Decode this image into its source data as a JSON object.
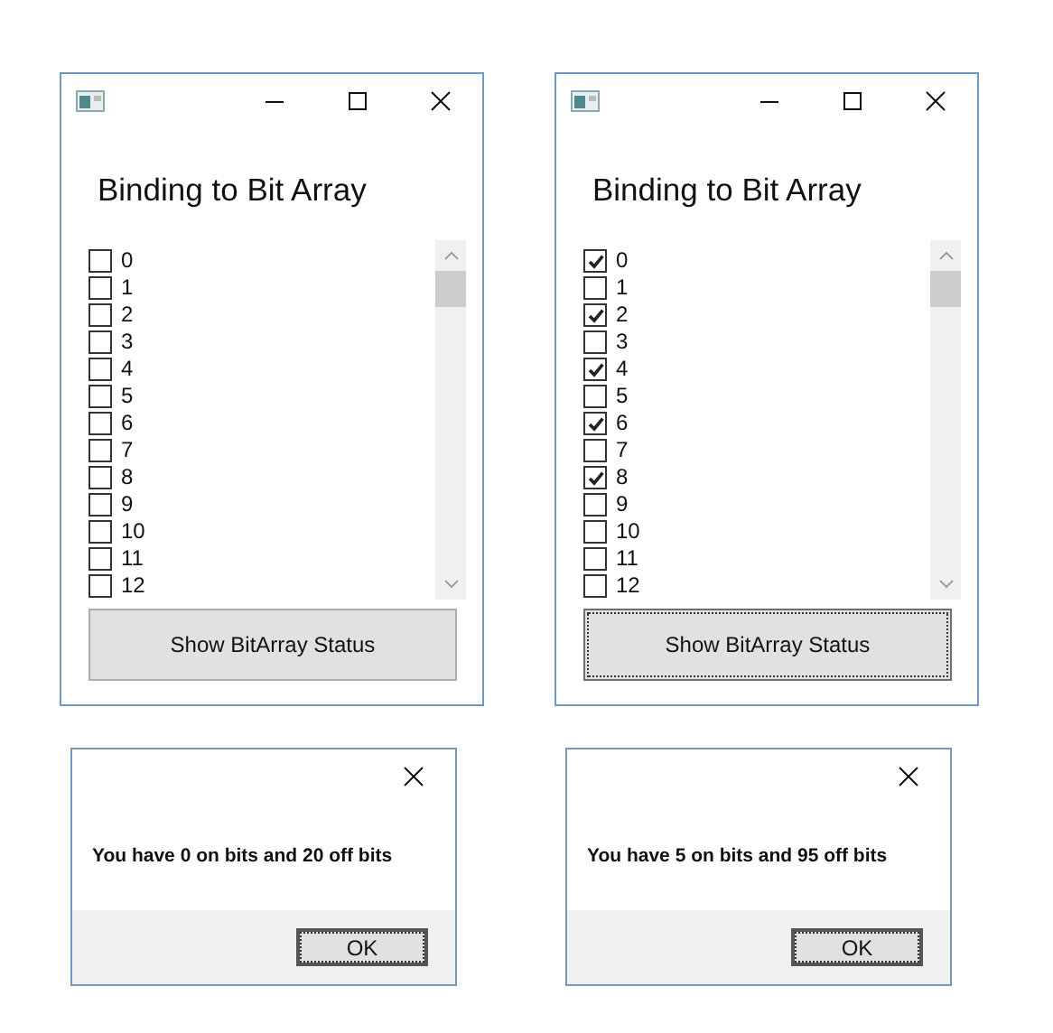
{
  "windows": [
    {
      "title": "Binding to Bit Array",
      "items": [
        {
          "label": "0",
          "checked": false
        },
        {
          "label": "1",
          "checked": false
        },
        {
          "label": "2",
          "checked": false
        },
        {
          "label": "3",
          "checked": false
        },
        {
          "label": "4",
          "checked": false
        },
        {
          "label": "5",
          "checked": false
        },
        {
          "label": "6",
          "checked": false
        },
        {
          "label": "7",
          "checked": false
        },
        {
          "label": "8",
          "checked": false
        },
        {
          "label": "9",
          "checked": false
        },
        {
          "label": "10",
          "checked": false
        },
        {
          "label": "11",
          "checked": false
        },
        {
          "label": "12",
          "checked": false
        }
      ],
      "button": {
        "label": "Show BitArray Status",
        "focused": false
      }
    },
    {
      "title": "Binding to Bit Array",
      "items": [
        {
          "label": "0",
          "checked": true
        },
        {
          "label": "1",
          "checked": false
        },
        {
          "label": "2",
          "checked": true
        },
        {
          "label": "3",
          "checked": false
        },
        {
          "label": "4",
          "checked": true
        },
        {
          "label": "5",
          "checked": false
        },
        {
          "label": "6",
          "checked": true
        },
        {
          "label": "7",
          "checked": false
        },
        {
          "label": "8",
          "checked": true
        },
        {
          "label": "9",
          "checked": false
        },
        {
          "label": "10",
          "checked": false
        },
        {
          "label": "11",
          "checked": false
        },
        {
          "label": "12",
          "checked": false
        }
      ],
      "button": {
        "label": "Show BitArray Status",
        "focused": true
      }
    }
  ],
  "dialogs": [
    {
      "message": "You have 0 on bits and 20 off bits",
      "button": {
        "label": "OK",
        "focused": true
      }
    },
    {
      "message": "You have 5 on bits and 95 off bits",
      "button": {
        "label": "OK",
        "focused": true
      }
    }
  ]
}
